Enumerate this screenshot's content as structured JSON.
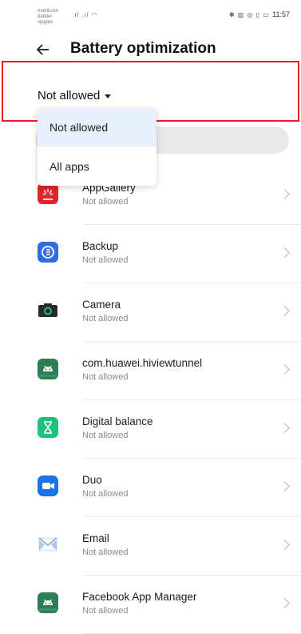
{
  "status_bar": {
    "carrier": "mobilcom-debitel",
    "carrier_sub": "sipgate",
    "signal": "⁠.ıl ⁠.ıl ⁠◠",
    "icons": "✱ ▥ ◎ ▯ ▭",
    "time": "11:57"
  },
  "header": {
    "title": "Battery optimization",
    "back_icon": "arrow-left-icon"
  },
  "filter": {
    "selected": "Not allowed"
  },
  "dropdown": {
    "options": [
      {
        "label": "Not allowed",
        "selected": true
      },
      {
        "label": "All apps",
        "selected": false
      }
    ]
  },
  "apps": [
    {
      "name": "AppGallery",
      "status": "Not allowed",
      "icon": "huawei-appgallery-icon",
      "color": "#e0252d"
    },
    {
      "name": "Backup",
      "status": "Not allowed",
      "icon": "backup-icon",
      "color": "#2f6de0"
    },
    {
      "name": "Camera",
      "status": "Not allowed",
      "icon": "camera-icon",
      "color": "#2b2b2b"
    },
    {
      "name": "com.huawei.hiviewtunnel",
      "status": "Not allowed",
      "icon": "android-icon",
      "color": "#2f7d56"
    },
    {
      "name": "Digital balance",
      "status": "Not allowed",
      "icon": "hourglass-icon",
      "color": "#1ec07a"
    },
    {
      "name": "Duo",
      "status": "Not allowed",
      "icon": "video-camera-icon",
      "color": "#1a73e8"
    },
    {
      "name": "Email",
      "status": "Not allowed",
      "icon": "envelope-icon",
      "color": "#6aa7e0"
    },
    {
      "name": "Facebook App Manager",
      "status": "Not allowed",
      "icon": "android-icon",
      "color": "#2f7d56"
    }
  ]
}
